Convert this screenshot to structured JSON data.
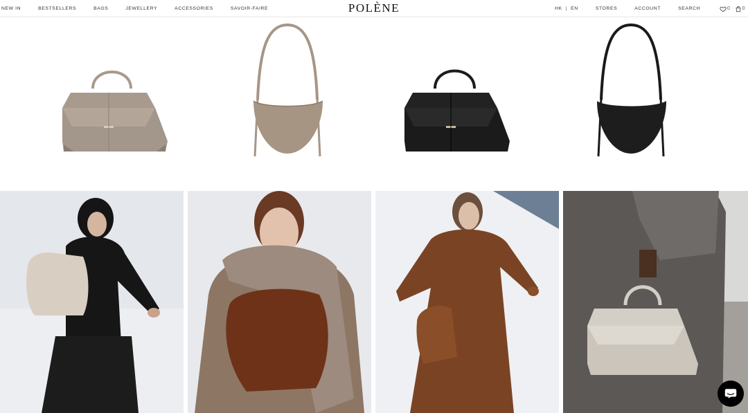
{
  "header": {
    "nav_left": [
      "NEW IN",
      "BESTSELLERS",
      "BAGS",
      "JEWELLERY",
      "ACCESSORIES",
      "SAVOIR-FAIRE"
    ],
    "logo": "POLÈNE",
    "region": "HK",
    "language": "EN",
    "stores": "STORES",
    "account": "ACCOUNT",
    "search": "SEARCH",
    "wishlist_count": "0",
    "cart_count": "0"
  },
  "products": [
    {
      "name": "taupe-top-handle-bag",
      "color": "#a79a8d"
    },
    {
      "name": "taupe-crescent-shoulder-bag",
      "color": "#a59486"
    },
    {
      "name": "black-top-handle-bag",
      "color": "#1d1d1d"
    },
    {
      "name": "black-crescent-shoulder-bag",
      "color": "#1a1a1a"
    }
  ],
  "editorial": [
    {
      "name": "model-black-coat-backpack"
    },
    {
      "name": "model-grey-scarf-brown-bag"
    },
    {
      "name": "model-camel-coat-bucket-bag"
    },
    {
      "name": "model-grey-knit-handbag"
    }
  ],
  "colors": {
    "snow": "#e7e9ee",
    "text": "#333333",
    "chat": "#000000"
  }
}
